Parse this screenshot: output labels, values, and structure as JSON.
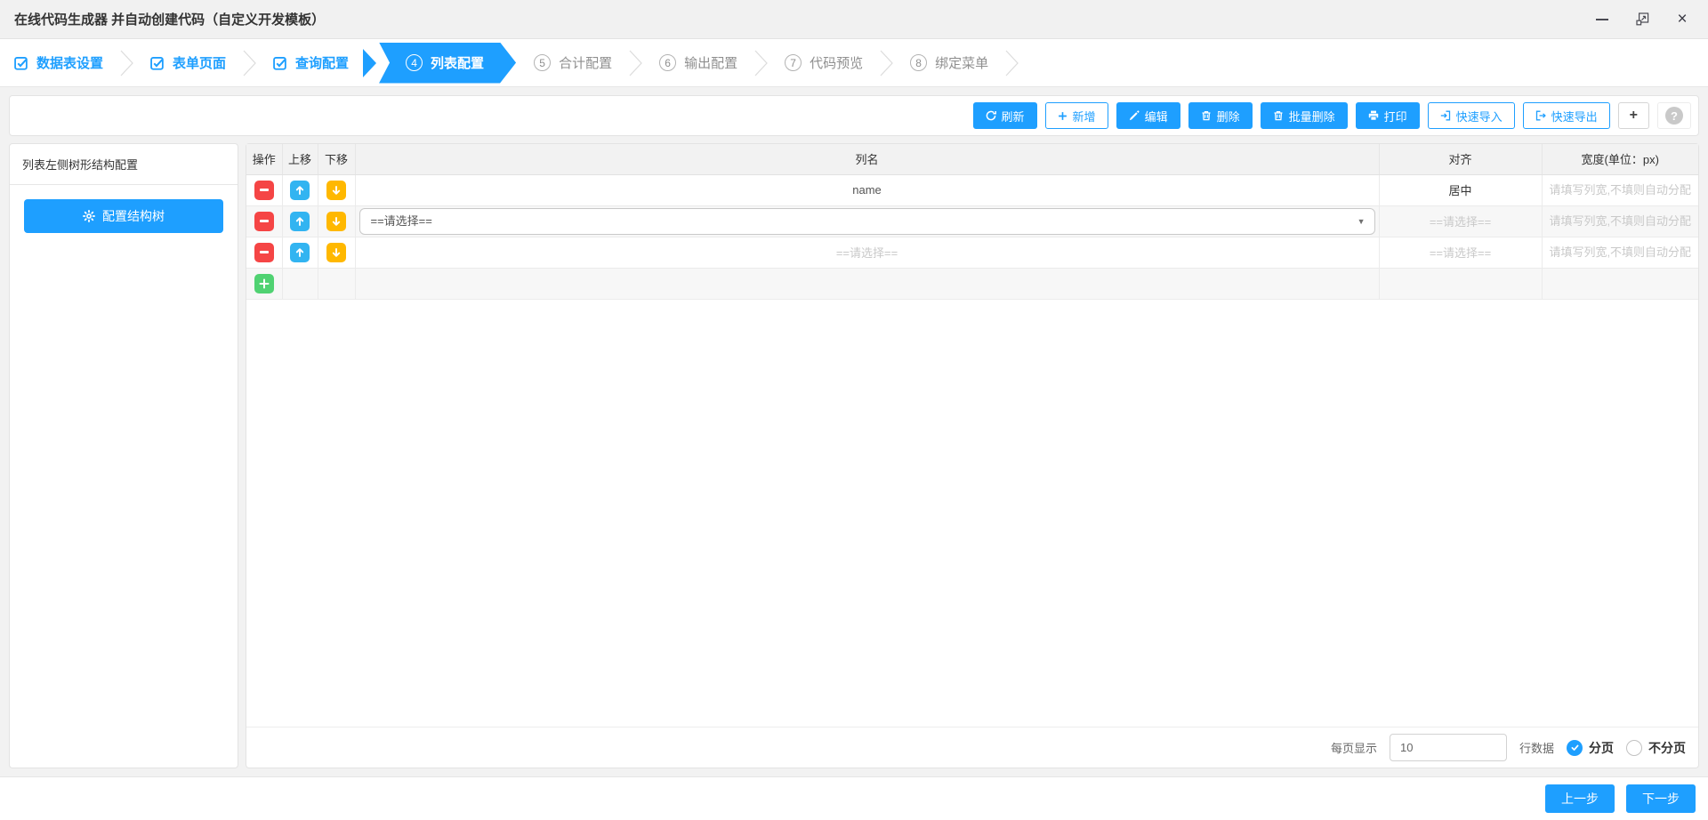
{
  "window": {
    "title": "在线代码生成器 并自动创建代码（自定义开发模板）"
  },
  "steps": [
    {
      "label": "数据表设置",
      "status": "done"
    },
    {
      "label": "表单页面",
      "status": "done"
    },
    {
      "label": "查询配置",
      "status": "done"
    },
    {
      "label": "列表配置",
      "status": "active",
      "number": "4"
    },
    {
      "label": "合计配置",
      "status": "pending",
      "number": "5"
    },
    {
      "label": "输出配置",
      "status": "pending",
      "number": "6"
    },
    {
      "label": "代码预览",
      "status": "pending",
      "number": "7"
    },
    {
      "label": "绑定菜单",
      "status": "pending",
      "number": "8"
    }
  ],
  "toolbar": {
    "buttons": [
      {
        "label": "刷新",
        "variant": "solid",
        "icon": "refresh-icon"
      },
      {
        "label": "新增",
        "variant": "outline",
        "icon": "plus-icon"
      },
      {
        "label": "编辑",
        "variant": "solid",
        "icon": "pencil-icon"
      },
      {
        "label": "删除",
        "variant": "solid",
        "icon": "trash-icon"
      },
      {
        "label": "批量删除",
        "variant": "solid",
        "icon": "trash-icon"
      },
      {
        "label": "打印",
        "variant": "solid",
        "icon": "printer-icon"
      },
      {
        "label": "快速导入",
        "variant": "outline",
        "icon": "sign-in-icon"
      },
      {
        "label": "快速导出",
        "variant": "outline",
        "icon": "sign-out-icon"
      },
      {
        "label": "+",
        "variant": "plain",
        "icon": "plus-icon"
      },
      {
        "label": "?",
        "variant": "help",
        "icon": "question-icon"
      }
    ]
  },
  "sidebar": {
    "title": "列表左侧树形结构配置",
    "tree_button_label": "配置结构树"
  },
  "table": {
    "headers": [
      "操作",
      "上移",
      "下移",
      "列名",
      "对齐",
      "宽度(单位：px)"
    ],
    "rows": [
      {
        "col_name": "name",
        "align": "居中",
        "width_placeholder": "请填写列宽,不填则自动分配"
      },
      {
        "col_name_selected": "==请选择==",
        "align_placeholder": "==请选择==",
        "width_placeholder": "请填写列宽,不填则自动分配"
      },
      {
        "col_name_placeholder": "==请选择==",
        "align_placeholder": "==请选择==",
        "width_placeholder": "请填写列宽,不填则自动分配"
      }
    ]
  },
  "pagination": {
    "per_page_label": "每页显示",
    "per_page_value": "10",
    "rows_suffix_label": "行数据",
    "paged_label": "分页",
    "unpaged_label": "不分页",
    "selected": "分页"
  },
  "footer": {
    "prev_label": "上一步",
    "next_label": "下一步"
  },
  "icons": {
    "minimize": "—",
    "maximize": "⧉",
    "close": "×",
    "refresh": "⟳",
    "plus": "+",
    "pencil": "✎",
    "trash": "🗑",
    "printer": "⎙",
    "sign-in": "⇥",
    "sign-out": "⇤",
    "gear": "⚙",
    "question": "?",
    "check": "✓",
    "arrow-up": "↑",
    "arrow-down": "↓",
    "minus": "−",
    "dropdown": "▼"
  },
  "colors": {
    "primary": "#1E9FFF",
    "danger": "#f54545",
    "warning": "#FFB800",
    "success": "#50d272",
    "titlebar_bg": "#f1f1f1",
    "page_bg": "#f2f2f2",
    "table_header_bg": "#f2f2f2",
    "row_alt_bg": "#f7f7f7",
    "ghost_text": "#c9c9c9"
  }
}
